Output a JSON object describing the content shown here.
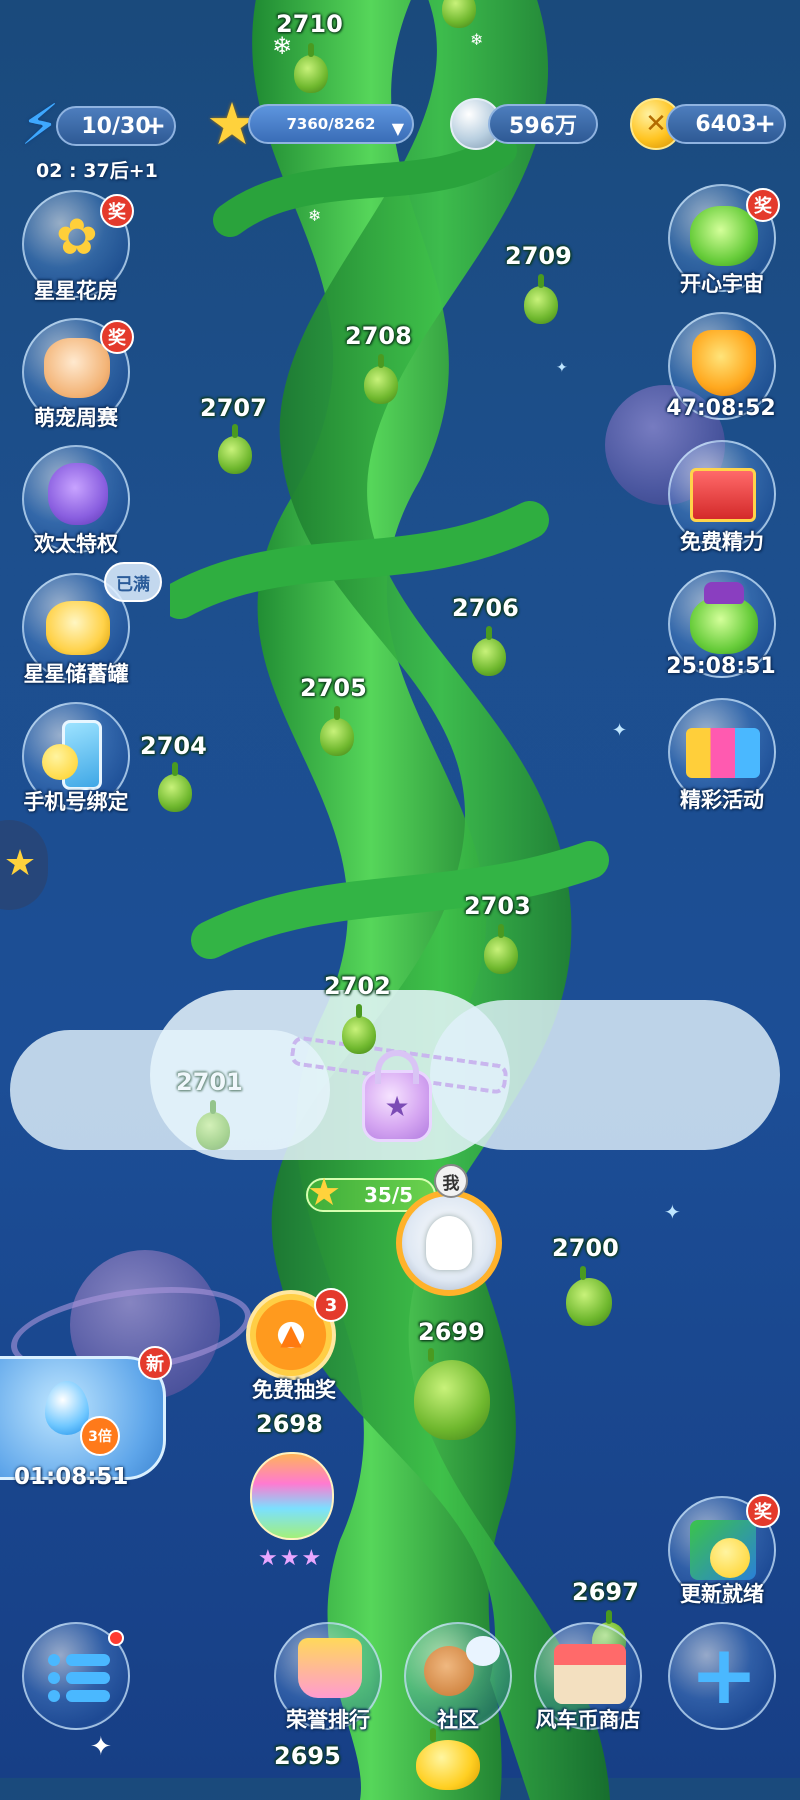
{
  "top_bar": {
    "energy": "10/30",
    "energy_timer": "02 : 37后+1",
    "stars": "7360/8262",
    "silver": "596万",
    "coins": "6403",
    "plus": "+"
  },
  "left_menu": [
    {
      "label": "星星花房",
      "badge": "奖"
    },
    {
      "label": "萌宠周赛",
      "badge": "奖"
    },
    {
      "label": "欢太特权",
      "badge": ""
    },
    {
      "label": "星星储蓄罐",
      "badge": "已满"
    },
    {
      "label": "手机号绑定",
      "badge": ""
    }
  ],
  "right_menu": [
    {
      "label": "开心宇宙",
      "badge": "奖"
    },
    {
      "label": "47:08:52",
      "badge": ""
    },
    {
      "label": "免费精力",
      "badge": ""
    },
    {
      "label": "25:08:51",
      "badge": ""
    },
    {
      "label": "精彩活动",
      "badge": ""
    }
  ],
  "levels": [
    "2710",
    "2709",
    "2708",
    "2707",
    "2706",
    "2705",
    "2704",
    "2703",
    "2702",
    "2701",
    "2700",
    "2699",
    "2698",
    "2697",
    "2695"
  ],
  "lock": {
    "stars": "35/5",
    "me_label": "我"
  },
  "lottery": {
    "label": "免费抽奖",
    "count": "3"
  },
  "water_event": {
    "new_badge": "新",
    "multiplier": "3倍",
    "timer": "01:08:51"
  },
  "update_ready": {
    "label": "更新就绪",
    "badge": "奖"
  },
  "bottom_bar": {
    "rank": "荣誉排行",
    "community": "社区",
    "shop": "风车币商店"
  },
  "colors": {
    "accent": "#ffd44a",
    "badge_red": "#e43a2c",
    "stalk": "#3dbb4a"
  }
}
